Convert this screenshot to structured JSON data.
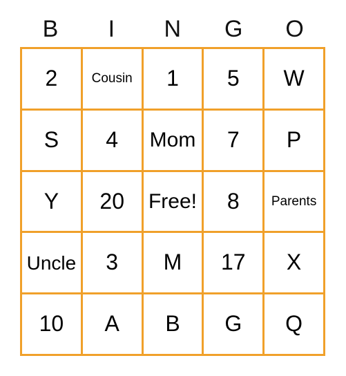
{
  "card": {
    "type": "bingo-card",
    "columns": 5,
    "rows": 5,
    "accent_color": "#F0A02A",
    "background_color": "#FFFFFF",
    "text_color": "#000000",
    "header": [
      "B",
      "I",
      "N",
      "G",
      "O"
    ],
    "cells": [
      [
        {
          "text": "2",
          "size": "lg"
        },
        {
          "text": "Cousin",
          "size": "xs"
        },
        {
          "text": "1",
          "size": "lg"
        },
        {
          "text": "5",
          "size": "lg"
        },
        {
          "text": "W",
          "size": "lg"
        }
      ],
      [
        {
          "text": "S",
          "size": "lg"
        },
        {
          "text": "4",
          "size": "lg"
        },
        {
          "text": "Mom",
          "size": "md"
        },
        {
          "text": "7",
          "size": "lg"
        },
        {
          "text": "P",
          "size": "lg"
        }
      ],
      [
        {
          "text": "Y",
          "size": "lg"
        },
        {
          "text": "20",
          "size": "lg"
        },
        {
          "text": "Free!",
          "size": "md"
        },
        {
          "text": "8",
          "size": "lg"
        },
        {
          "text": "Parents",
          "size": "xs"
        }
      ],
      [
        {
          "text": "Uncle",
          "size": "sm"
        },
        {
          "text": "3",
          "size": "lg"
        },
        {
          "text": "M",
          "size": "lg"
        },
        {
          "text": "17",
          "size": "lg"
        },
        {
          "text": "X",
          "size": "lg"
        }
      ],
      [
        {
          "text": "10",
          "size": "lg"
        },
        {
          "text": "A",
          "size": "lg"
        },
        {
          "text": "B",
          "size": "lg"
        },
        {
          "text": "G",
          "size": "lg"
        },
        {
          "text": "Q",
          "size": "lg"
        }
      ]
    ],
    "free_space": {
      "row": 3,
      "column": 3,
      "label": "Free!"
    }
  }
}
